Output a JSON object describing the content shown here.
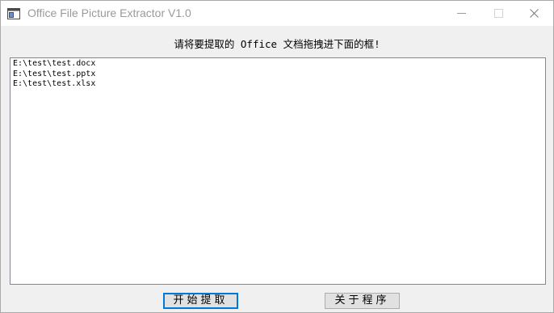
{
  "window": {
    "title": "Office File Picture Extractor V1.0"
  },
  "titlebar_icons": {
    "app": "app-window-icon",
    "minimize": "minimize-icon",
    "maximize": "maximize-icon",
    "close": "close-icon"
  },
  "prompt": "请将要提取的 Office 文档拖拽进下面的框!",
  "file_list": [
    "E:\\test\\test.docx",
    "E:\\test\\test.pptx",
    "E:\\test\\test.xlsx"
  ],
  "buttons": {
    "start_label": "开始提取",
    "about_label": "关于程序"
  },
  "colors": {
    "focus_border": "#0078d7",
    "title_text": "#9a9a9a"
  }
}
